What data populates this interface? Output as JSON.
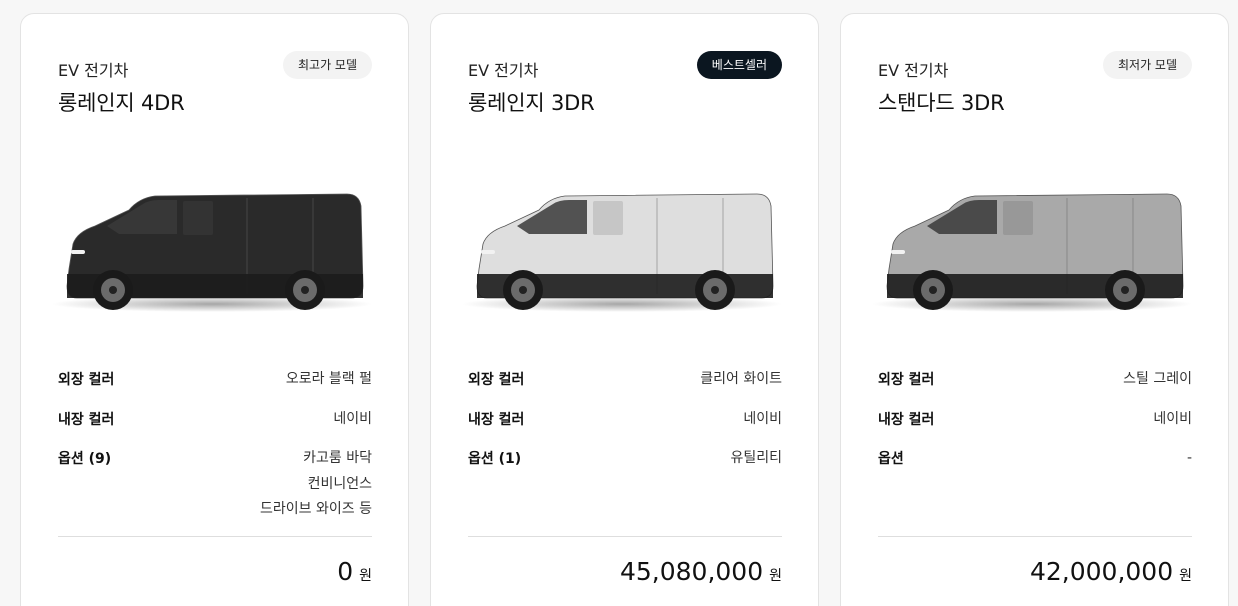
{
  "cards": [
    {
      "category": "EV 전기차",
      "model": "롱레인지 4DR",
      "badge": "최고가 모델",
      "badge_style": "light",
      "van_color": "#2a2a2a",
      "specs": {
        "exterior_label": "외장 컬러",
        "exterior_value": "오로라 블랙 펄",
        "interior_label": "내장 컬러",
        "interior_value": "네이비",
        "options_label": "옵션 (9)",
        "options_values": [
          "카고룸 바닥",
          "컨비니언스",
          "드라이브 와이즈 등"
        ]
      },
      "price": "0",
      "currency": "원"
    },
    {
      "category": "EV 전기차",
      "model": "롱레인지 3DR",
      "badge": "베스트셀러",
      "badge_style": "dark",
      "van_color": "#dedede",
      "specs": {
        "exterior_label": "외장 컬러",
        "exterior_value": "클리어 화이트",
        "interior_label": "내장 컬러",
        "interior_value": "네이비",
        "options_label": "옵션 (1)",
        "options_values": [
          "유틸리티"
        ]
      },
      "price": "45,080,000",
      "currency": "원"
    },
    {
      "category": "EV 전기차",
      "model": "스탠다드 3DR",
      "badge": "최저가 모델",
      "badge_style": "light",
      "van_color": "#a9a9a9",
      "specs": {
        "exterior_label": "외장 컬러",
        "exterior_value": "스틸 그레이",
        "interior_label": "내장 컬러",
        "interior_value": "네이비",
        "options_label": "옵션",
        "options_values": [
          "-"
        ]
      },
      "price": "42,000,000",
      "currency": "원"
    }
  ]
}
